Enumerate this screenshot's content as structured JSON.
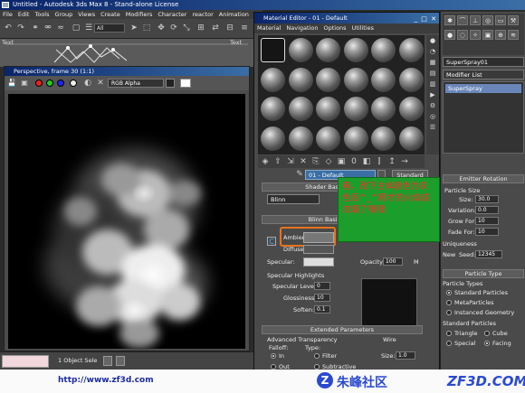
{
  "main_window": {
    "title": "Untitled - Autodesk 3ds Max 8 - Stand-alone License",
    "menu": [
      "File",
      "Edit",
      "Tools",
      "Group",
      "Views",
      "Create",
      "Modifiers",
      "Character",
      "reactor",
      "Animation"
    ],
    "selection_filter": "All"
  },
  "trackbar": {
    "label_left": "Text",
    "label_right": "Text"
  },
  "frame_window": {
    "title": "Perspective, frame 30 (1:1)",
    "channel": "RGB Alpha"
  },
  "status": {
    "selected": "1 Object Sele"
  },
  "material_editor": {
    "title": "Material Editor - 01 - Default",
    "menu": [
      "Material",
      "Navigation",
      "Options",
      "Utilities"
    ],
    "material_name": "01 - Default",
    "material_type": "Standard",
    "shader_basic_rollout": "Shader Basic Parameters",
    "shader_type": "Blinn",
    "blinn_basic_rollout": "Blinn Basic Parameters",
    "ambient_label": "Ambient:",
    "diffuse_label": "Diffuse:",
    "specular_label": "Specular:",
    "opacity_label": "Opacity:",
    "opacity_value": "100",
    "specular_highlights": "Specular Highlights",
    "specular_level_label": "Specular Level:",
    "specular_level_value": "0",
    "glossiness_label": "Glossiness:",
    "glossiness_value": "10",
    "soften_label": "Soften:",
    "soften_value": "0.1",
    "extended_rollout": "Extended Parameters",
    "advanced_transparency": "Advanced Transparency",
    "falloff_label": "Falloff:",
    "type_label": "Type:",
    "falloff_in": "In",
    "falloff_out": "Out",
    "type_filter": "Filter",
    "type_subtractive": "Subtractive",
    "wire_label": "Wire",
    "wire_size_label": "Size:",
    "wire_size_value": "1.0"
  },
  "annotation_note": "看，改下主体颜色为灰色后^_^刚才的火焰成浓烟了嘿嘿",
  "command_panel": {
    "object_name": "SuperSpray01",
    "modifier_list": "Modifier List",
    "stack_item": "SuperSpray",
    "emitter_rotation": "Emitter Rotation",
    "particle_size_label": "Particle Size",
    "size_label": "Size:",
    "size_value": "30.0",
    "variation_label": "Variation:",
    "variation_value": "0.0",
    "grow_for_label": "Grow For:",
    "grow_for_value": "10",
    "fade_for_label": "Fade For:",
    "fade_for_value": "10",
    "uniqueness_label": "Uniqueness",
    "new_label": "New",
    "seed_label": "Seed:",
    "seed_value": "12345",
    "particle_type_rollout": "Particle Type",
    "particle_types_label": "Particle Types",
    "standard_particles": "Standard Particles",
    "metaparticles": "MetaParticles",
    "instanced_geometry": "Instanced Geometry",
    "standard_particles_group": "Standard Particles",
    "triangle": "Triangle",
    "cube": "Cube",
    "special": "Special",
    "facing": "Facing"
  },
  "watermark": {
    "url": "http://www.zf3d.com",
    "site_name": "朱峰社区",
    "site_logo": "ZF3D.COM"
  },
  "colors": {
    "accent": "#3a6ea5",
    "note_bg": "#1c9e2c",
    "note_text": "#ff2a2a",
    "highlight": "#e8731c"
  }
}
